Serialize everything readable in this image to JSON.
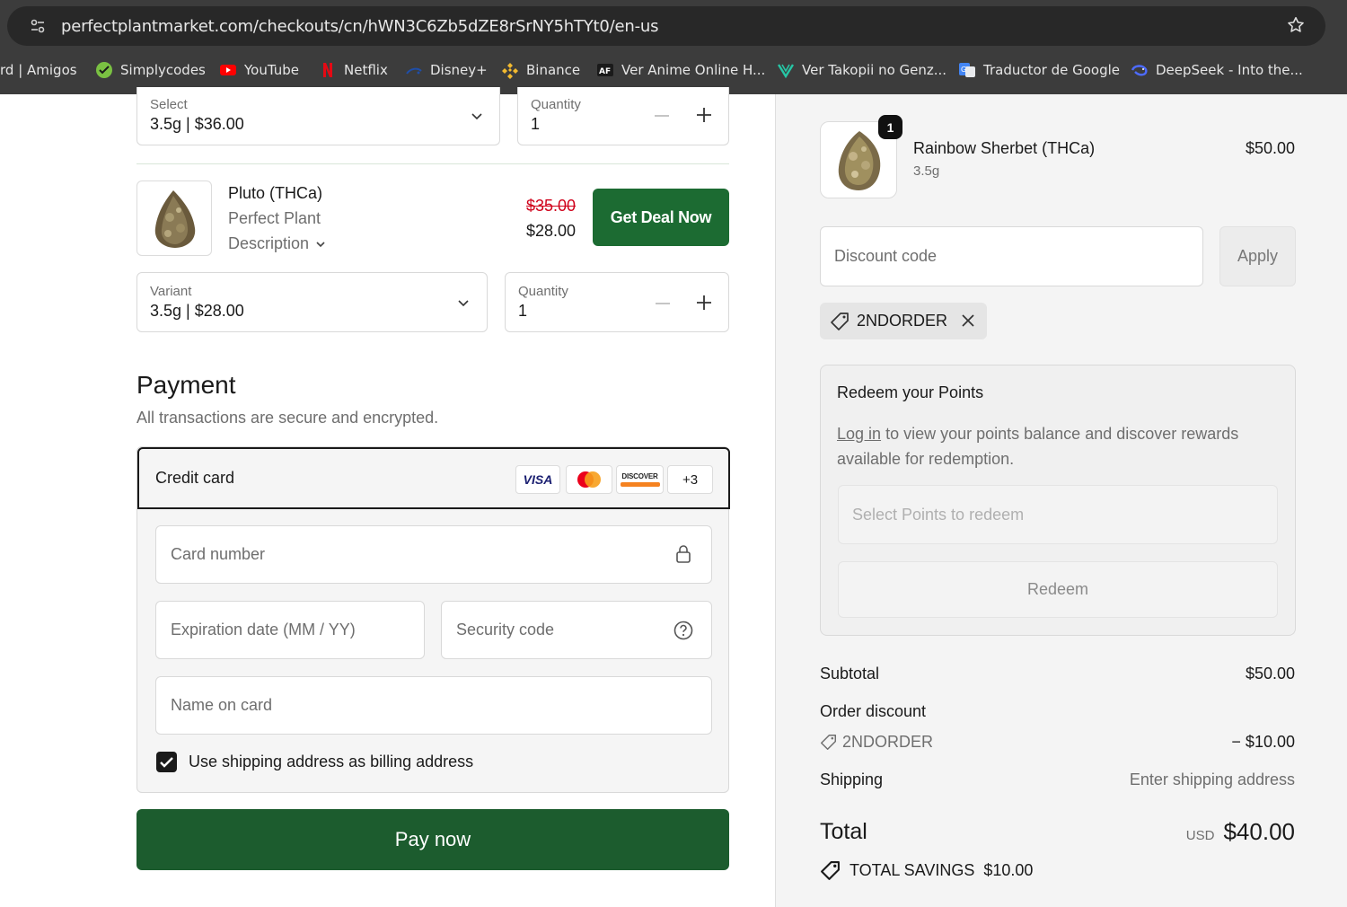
{
  "browser": {
    "url": "perfectplantmarket.com/checkouts/cn/hWN3C6Zb5dZE8rSrNY5hTYt0/en-us",
    "bookmarks": [
      {
        "label": "rd | Amigos",
        "icon": "none"
      },
      {
        "label": "Simplycodes",
        "icon": "simplycodes-icon"
      },
      {
        "label": "YouTube",
        "icon": "youtube-icon"
      },
      {
        "label": "Netflix",
        "icon": "netflix-icon"
      },
      {
        "label": "Disney+",
        "icon": "disney-icon"
      },
      {
        "label": "Binance",
        "icon": "binance-icon"
      },
      {
        "label": "Ver Anime Online H...",
        "icon": "animeflv-icon"
      },
      {
        "label": "Ver Takopii no Genz...",
        "icon": "takopii-icon"
      },
      {
        "label": "Traductor de Google",
        "icon": "google-translate-icon"
      },
      {
        "label": "DeepSeek - Into the...",
        "icon": "deepseek-icon"
      }
    ]
  },
  "upsell": {
    "top_item": {
      "select_label": "Select",
      "select_value": "3.5g | $36.00",
      "quantity_label": "Quantity",
      "quantity_value": "1"
    },
    "product": {
      "name": "Pluto (THCa)",
      "vendor": "Perfect Plant",
      "description_toggle": "Description",
      "original_price": "$35.00",
      "deal_price": "$28.00",
      "deal_button": "Get Deal Now",
      "variant_label": "Variant",
      "variant_value": "3.5g | $28.00",
      "quantity_label": "Quantity",
      "quantity_value": "1"
    }
  },
  "payment": {
    "title": "Payment",
    "subtitle": "All transactions are secure and encrypted.",
    "method": "Credit card",
    "card_brands": [
      "VISA",
      "Mastercard",
      "DISCOVER"
    ],
    "more_brands": "+3",
    "card_number_placeholder": "Card number",
    "expiry_placeholder": "Expiration date (MM / YY)",
    "security_placeholder": "Security code",
    "name_placeholder": "Name on card",
    "billing_checkbox_label": "Use shipping address as billing address",
    "billing_checked": true,
    "pay_button": "Pay now"
  },
  "summary": {
    "item": {
      "quantity": "1",
      "name": "Rainbow Sherbet (THCa)",
      "variant": "3.5g",
      "price": "$50.00"
    },
    "discount_placeholder": "Discount code",
    "apply_button": "Apply",
    "applied_code": "2NDORDER",
    "redeem": {
      "title": "Redeem your Points",
      "login_link": "Log in",
      "text": "to view your points balance and discover rewards available for redemption.",
      "select_placeholder": "Select Points to redeem",
      "redeem_button": "Redeem"
    },
    "subtotal_label": "Subtotal",
    "subtotal_value": "$50.00",
    "order_discount_label": "Order discount",
    "discount_code": "2NDORDER",
    "discount_value": "− $10.00",
    "shipping_label": "Shipping",
    "shipping_value": "Enter shipping address",
    "total_label": "Total",
    "currency": "USD",
    "total_value": "$40.00",
    "savings_label": "TOTAL SAVINGS",
    "savings_value": "$10.00"
  },
  "colors": {
    "primary_green": "#1c5c2e",
    "deal_green": "#1c6b32",
    "strike_red": "#d0021b",
    "chrome_dark": "#3c3c3c"
  }
}
